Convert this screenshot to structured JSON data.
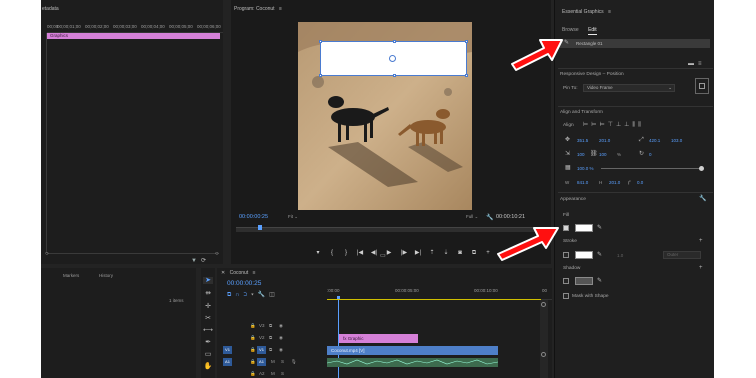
{
  "source_panel": {
    "title": "etadata",
    "ruler_labels": [
      "00;00",
      "00;00;01;00",
      "00;00;02;00",
      "00;00;03;00",
      "00;00;04;00",
      "00;00;05;00",
      "00;00;06;00"
    ],
    "graphics_clip": "Graphics"
  },
  "program": {
    "title": "Program: Coconut",
    "menu_icon": "hamburger-icon",
    "timecode_left": "00:00:00:25",
    "fit_select": "Fit",
    "full_select": "Full",
    "timecode_right": "00:00:10:21"
  },
  "essential_graphics": {
    "title": "Essential Graphics",
    "tabs": [
      "Browse",
      "Edit"
    ],
    "active_tab": "Edit",
    "layer_name": "Rectangle 01",
    "responsive_title": "Responsive Design – Position",
    "pin_to_label": "Pin To:",
    "pin_to_value": "Video Frame",
    "align_title": "Align and Transform",
    "align_label": "Align",
    "position_x": "351.5",
    "position_y": "201.0",
    "anchor_x": "420.1",
    "anchor_y": "103.0",
    "scale": "100",
    "scale_unit": "%",
    "rotation": "0",
    "opacity": "100.0 %",
    "width_label": "W",
    "width_value": "841.0",
    "height_label": "H",
    "height_value": "201.0",
    "corner_value": "0.0",
    "appearance_title": "Appearance",
    "fill_label": "Fill",
    "stroke_label": "Stroke",
    "stroke_value": "1.0",
    "stroke_align": "Outer",
    "shadow_label": "Shadow",
    "mask_label": "Mask with Shape",
    "fill_color": "#ffffff",
    "stroke_color": "#ffffff"
  },
  "project": {
    "tabs": [
      "Markers",
      "History"
    ],
    "items": "1 items"
  },
  "timeline": {
    "title": "Coconut",
    "timecode": "00:00:00:25",
    "ruler_labels": [
      ":00:00",
      "00:00:05:00",
      "00:00:10:00",
      "00"
    ],
    "tracks": [
      {
        "name": "V3",
        "target": "",
        "selected": false
      },
      {
        "name": "V2",
        "target": "",
        "selected": false
      },
      {
        "name": "V1",
        "target": "V1",
        "selected": true
      },
      {
        "name": "A1",
        "target": "A1",
        "selected": true
      },
      {
        "name": "A2",
        "target": "",
        "selected": false
      }
    ],
    "graphic_clip": "Graphic",
    "video_clip": "Coconut.mp4 [V]"
  },
  "colors": {
    "accent_blue": "#5aa0ff",
    "graphics_clip": "#d580d8",
    "video_clip": "#4e7fc8",
    "playhead": "#5aa0ff",
    "callout_arrow": "#ff0000"
  }
}
